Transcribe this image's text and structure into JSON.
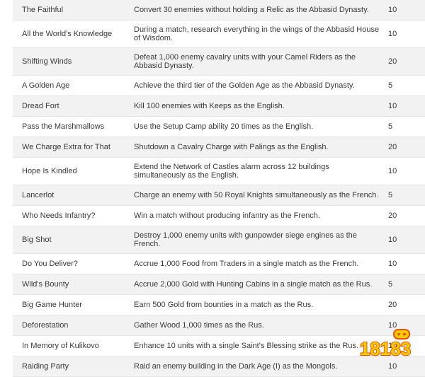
{
  "rows": [
    {
      "name": "The Faithful",
      "desc": "Convert 30 enemies without holding a Relic as the Abbasid Dynasty.",
      "points": "10"
    },
    {
      "name": "All the World's Knowledge",
      "desc": "During a match, research everything in the wings of the Abbasid House of Wisdom.",
      "points": "10"
    },
    {
      "name": "Shifting Winds",
      "desc": "Defeat 1,000 enemy cavalry units with your Camel Riders as the Abbasid Dynasty.",
      "points": "20"
    },
    {
      "name": "A Golden Age",
      "desc": "Achieve the third tier of the Golden Age as the Abbasid Dynasty.",
      "points": "5"
    },
    {
      "name": "Dread Fort",
      "desc": "Kill 100 enemies with Keeps as the English.",
      "points": "10"
    },
    {
      "name": "Pass the Marshmallows",
      "desc": "Use the Setup Camp ability 20 times as the English.",
      "points": "5"
    },
    {
      "name": "We Charge Extra for That",
      "desc": "Shutdown a Cavalry Charge with Palings as the English.",
      "points": "20"
    },
    {
      "name": "Hope Is Kindled",
      "desc": "Extend the Network of Castles alarm across 12 buildings simultaneously as the English.",
      "points": "10"
    },
    {
      "name": "Lancerlot",
      "desc": "Charge an enemy with 50 Royal Knights simultaneously as the French.",
      "points": "5"
    },
    {
      "name": "Who Needs Infantry?",
      "desc": "Win a match without producing infantry as the French.",
      "points": "20"
    },
    {
      "name": "Big Shot",
      "desc": "Destroy 1,000 enemy units with gunpowder siege engines as the French.",
      "points": "10"
    },
    {
      "name": "Do You Deliver?",
      "desc": "Accrue 1,000 Food from Traders in a single match as the French.",
      "points": "10"
    },
    {
      "name": "Wild's Bounty",
      "desc": "Accrue 2,000 Gold with Hunting Cabins in a single match as the Rus.",
      "points": "5"
    },
    {
      "name": "Big Game Hunter",
      "desc": "Earn 500 Gold from bounties in a match as the Rus.",
      "points": "20"
    },
    {
      "name": "Deforestation",
      "desc": "Gather Wood 1,000 times as the Rus.",
      "points": "10"
    },
    {
      "name": "In Memory of Kulikovo",
      "desc": "Enhance 10 units with a single Saint's Blessing strike as the Rus.",
      "points": "10"
    },
    {
      "name": "Raiding Party",
      "desc": "Raid an enemy building in the Dark Age (I) as the Mongols.",
      "points": "10"
    }
  ],
  "watermark": {
    "text": "18183",
    "color_fill": "#ffcc00",
    "color_stroke": "#e8530e"
  }
}
